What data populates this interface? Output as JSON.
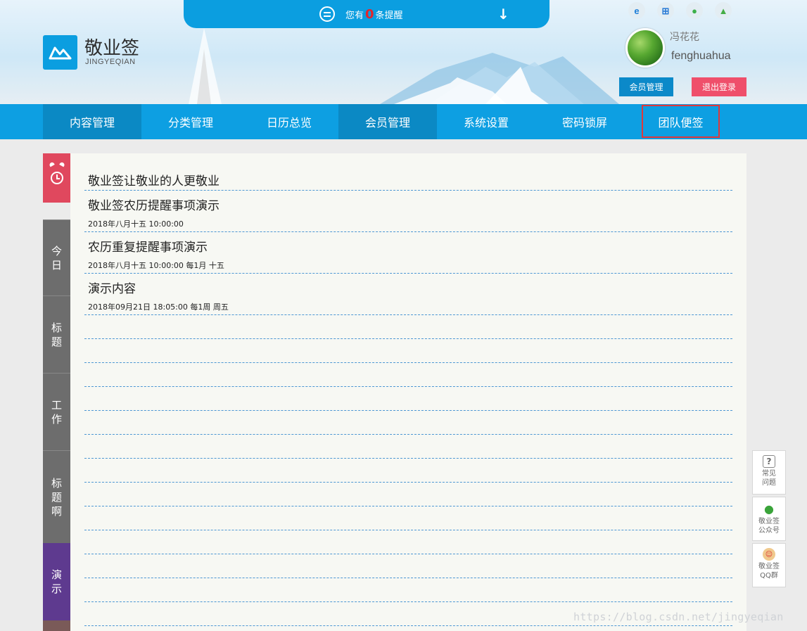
{
  "notice": {
    "prefix": "您有",
    "count": "0",
    "suffix": "条提醒"
  },
  "brand": {
    "title": "敬业签",
    "subtitle": "JINGYEQIAN",
    "color": "#0b9ee0"
  },
  "platforms": [
    "ie-icon",
    "windows-icon",
    "apple-icon",
    "android-icon"
  ],
  "user": {
    "name_cn": "冯花花",
    "name_en": "fenghuahua",
    "member_button": "会员管理",
    "logout_button": "退出登录"
  },
  "nav": {
    "items": [
      {
        "label": "内容管理"
      },
      {
        "label": "分类管理"
      },
      {
        "label": "日历总览"
      },
      {
        "label": "会员管理"
      },
      {
        "label": "系统设置"
      },
      {
        "label": "密码锁屏"
      },
      {
        "label": "团队便签"
      }
    ],
    "accent": "#0d9fe2"
  },
  "side_tabs": [
    {
      "chars": [
        "今",
        "日"
      ]
    },
    {
      "chars": [
        "标",
        "题"
      ]
    },
    {
      "chars": [
        "工",
        "作"
      ]
    },
    {
      "chars": [
        "标",
        "题",
        "啊"
      ]
    },
    {
      "chars": [
        "演",
        "示"
      ]
    }
  ],
  "items": [
    {
      "title": "敬业签让敬业的人更敬业",
      "meta": ""
    },
    {
      "title": "敬业签农历提醒事项演示",
      "meta": "2018年八月十五 10:00:00"
    },
    {
      "title": "农历重复提醒事项演示",
      "meta": "2018年八月十五 10:00:00 每1月 十五"
    },
    {
      "title": "演示内容",
      "meta": "2018年09月21日 18:05:00 每1周 周五"
    }
  ],
  "float_panel": [
    {
      "line1": "常见",
      "line2": "问题"
    },
    {
      "line1": "敬业签",
      "line2": "公众号"
    },
    {
      "line1": "敬业签",
      "line2": "QQ群"
    }
  ],
  "watermark": "https://blog.csdn.net/jingyeqian"
}
